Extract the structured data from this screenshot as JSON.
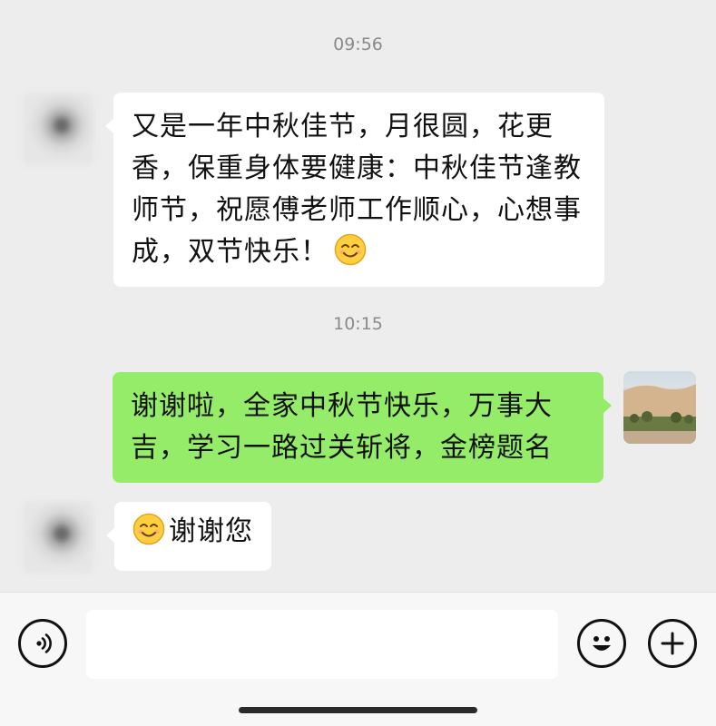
{
  "messages": [
    {
      "time": "09:56",
      "direction": "incoming",
      "text": "又是一年中秋佳节，月很圆，花更香，保重身体要健康：中秋佳节逢教师节，祝愿傅老师工作顺心，心想事成，双节快乐！",
      "emoji": "smiling-face"
    },
    {
      "time": "10:15",
      "direction": "outgoing",
      "text": "谢谢啦，全家中秋节快乐，万事大吉，学习一路过关斩将，金榜题名"
    },
    {
      "direction": "incoming",
      "text": "谢谢您",
      "emoji": "smiling-face"
    }
  ],
  "colors": {
    "background": "#ededed",
    "incoming_bubble": "#ffffff",
    "outgoing_bubble": "#95ec69",
    "timestamp": "#8a8a8a"
  },
  "icons": {
    "voice": "voice-wave-icon",
    "emoji": "emoji-face-icon",
    "add": "plus-icon"
  },
  "input": {
    "value": ""
  }
}
